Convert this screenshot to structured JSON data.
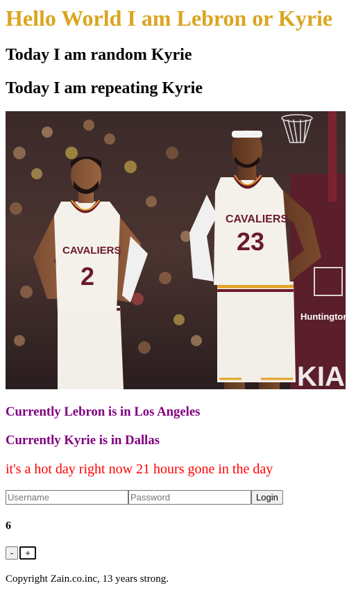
{
  "header": {
    "title": "Hello World I am Lebron or Kyrie",
    "random_line": "Today I am random Kyrie",
    "repeating_line": "Today I am repeating Kyrie"
  },
  "photo": {
    "players": [
      {
        "team_text": "CAVALIERS",
        "number": "2"
      },
      {
        "team_text": "CAVALIERS",
        "number": "23"
      }
    ],
    "arena_sign": "Huntington"
  },
  "locations": {
    "lebron": "Currently Lebron is in Los Angeles",
    "kyrie": "Currently Kyrie is in Dallas"
  },
  "weather": {
    "text": "it's a hot day right now 21 hours gone in the day"
  },
  "login": {
    "username_placeholder": "Username",
    "password_placeholder": "Password",
    "button_label": "Login"
  },
  "counter": {
    "value": "6",
    "decrement_label": "-",
    "increment_label": "+"
  },
  "footer": {
    "copyright": "Copyright Zain.co.inc, 13 years strong."
  },
  "colors": {
    "title": "#daa520",
    "locations": "#800080",
    "weather": "#ff0000",
    "jersey_maroon": "#6b1a2b",
    "jersey_gold": "#e3a325"
  }
}
